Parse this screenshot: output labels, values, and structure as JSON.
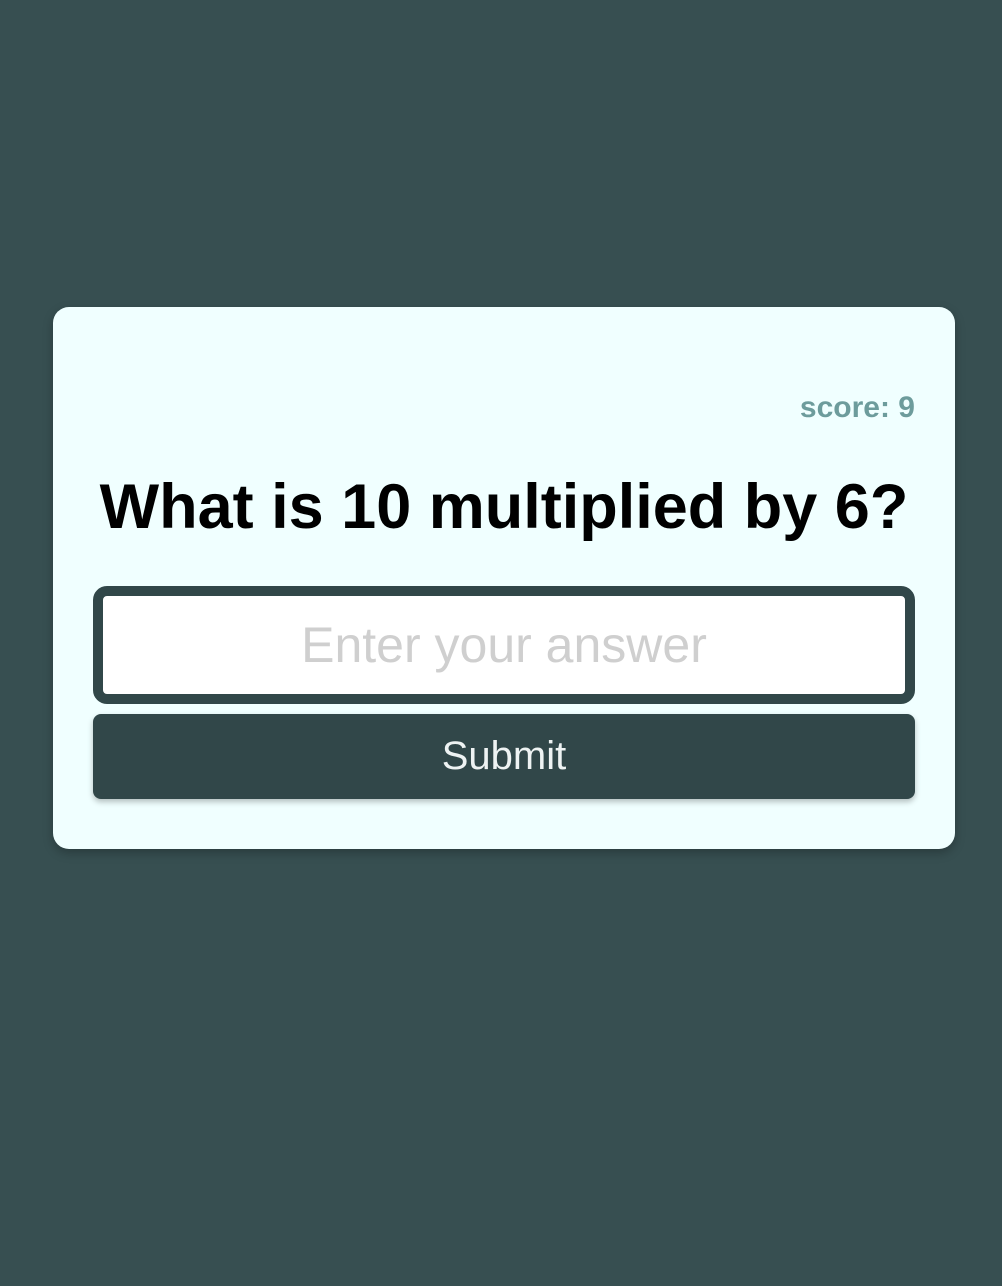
{
  "quiz": {
    "score": "score: 9",
    "question": "What is 10 multiplied by 6?",
    "answer_input": {
      "value": "",
      "placeholder": "Enter your answer"
    },
    "submit_label": "Submit"
  },
  "colors": {
    "page_background": "#374f51",
    "card_background": "#f0ffff",
    "accent_dark": "#314749",
    "score_text": "#6d9c9c",
    "placeholder_text": "#cfcfcf"
  }
}
